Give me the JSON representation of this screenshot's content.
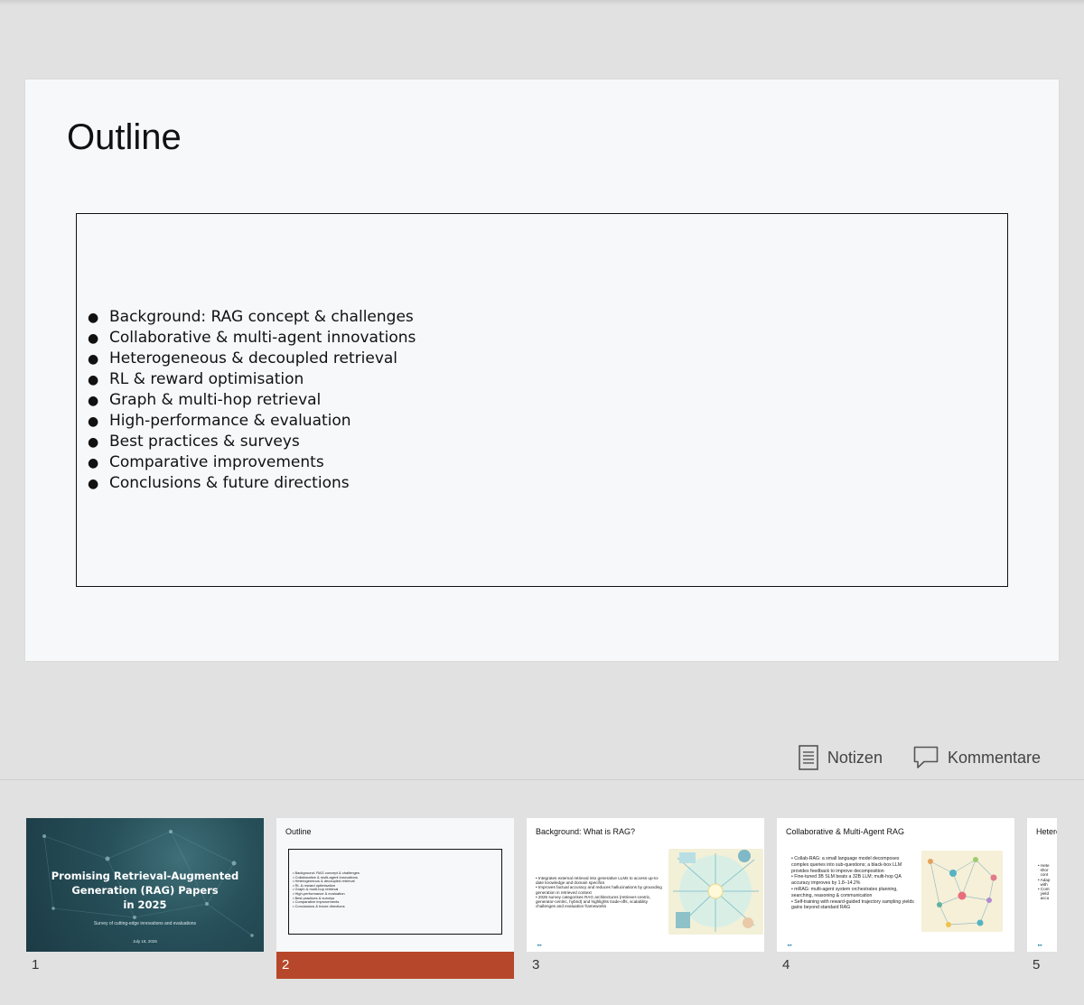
{
  "slide": {
    "title": "Outline",
    "bullets": [
      "Background: RAG concept & challenges",
      "Collaborative & multi-agent innovations",
      "Heterogeneous & decoupled retrieval",
      "RL & reward optimisation",
      "Graph & multi-hop retrieval",
      "High-performance & evaluation",
      "Best practices & surveys",
      "Comparative improvements",
      "Conclusions & future directions"
    ]
  },
  "toolbar": {
    "notes_label": "Notizen",
    "comments_label": "Kommentare"
  },
  "thumbnails": {
    "selected": 2,
    "items": [
      {
        "number": "1",
        "title": "Promising Retrieval-Augmented Generation (RAG) Papers in 2025",
        "title_lines": [
          "Promising Retrieval-Augmented",
          "Generation (RAG) Papers",
          "in 2025"
        ],
        "subtitle": "Survey of cutting-edge innovations and evaluations",
        "date": "July 18, 2025"
      },
      {
        "number": "2",
        "title": "Outline"
      },
      {
        "number": "3",
        "title": "Background: What is RAG?",
        "bullets": [
          "Integrates external retrieval into generative LLMs to access up-to-date knowledge and domain specifics",
          "Improves factual accuracy and reduces hallucinations by grounding generation in retrieved context",
          "2025 survey categorises RAG architectures (retriever-centric, generator-centric, hybrid) and highlights trade-offs, scalability challenges and evaluation frameworks"
        ]
      },
      {
        "number": "4",
        "title": "Collaborative & Multi-Agent RAG",
        "bullets": [
          "Collab-RAG: a small language model decomposes complex queries into sub-questions; a black-box LLM provides feedback to improve decomposition",
          "Fine-tuned 3B SLM beats a 32B LLM; multi-hop QA accuracy improves by 1.8–14.2%",
          "mRAG: multi-agent system orchestrates planning, searching, reasoning & communication",
          "Self-training with reward-guided trajectory sampling yields gains beyond standard RAG"
        ]
      },
      {
        "number": "5",
        "title": "Heterogeneous",
        "bullets": [
          "Hete",
          "shor",
          "cont",
          "Adap",
          "with",
          "Cont",
          "yield",
          "accu"
        ]
      }
    ]
  },
  "colors": {
    "selected_accent": "#b7472a",
    "app_background": "#e1e1e1"
  }
}
